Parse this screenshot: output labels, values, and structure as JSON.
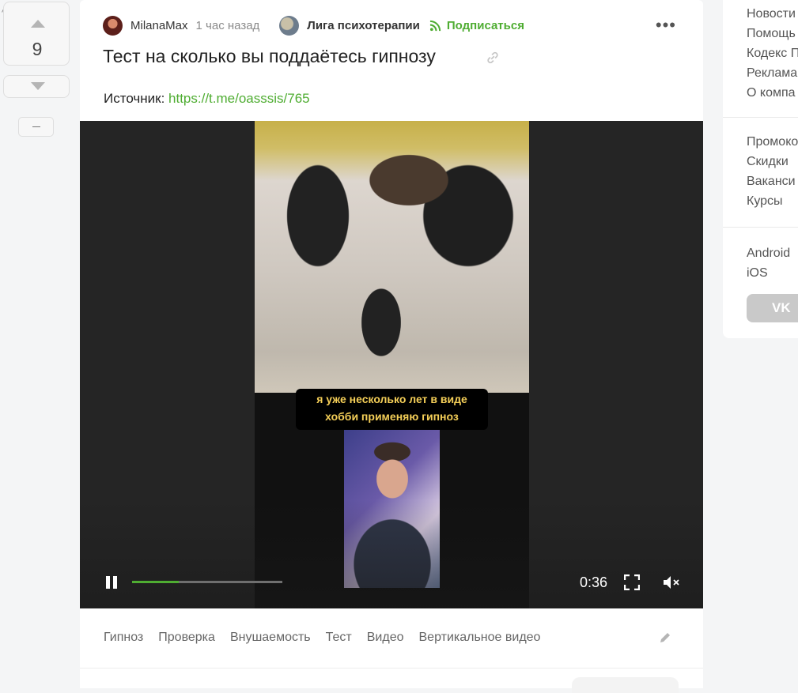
{
  "vote": {
    "count": "9"
  },
  "post": {
    "author": "MilanaMax",
    "time": "1 час назад",
    "community": "Лига психотерапии",
    "subscribe_label": "Подписаться",
    "title": "Тест на сколько вы поддаётесь гипнозу",
    "source_label": "Источник:",
    "source_url": "https://t.me/oasssis/765"
  },
  "video": {
    "caption_line1": "я уже несколько лет в виде",
    "caption_line2": "хобби применяю гипноз",
    "timecode": "0:36",
    "progress": 0.31,
    "accent_color": "#4fad32"
  },
  "tags": [
    "Гипноз",
    "Проверка",
    "Внушаемость",
    "Тест",
    "Видео",
    "Вертикальное видео"
  ],
  "sidebar": {
    "group1": [
      "Новости",
      "Помощь",
      "Кодекс П",
      "Реклама",
      "О компа"
    ],
    "group2": [
      "Промоко",
      "Скидки",
      "Ваканси",
      "Курсы"
    ],
    "group3": [
      "Android",
      "iOS"
    ],
    "vk_label": "VK"
  }
}
